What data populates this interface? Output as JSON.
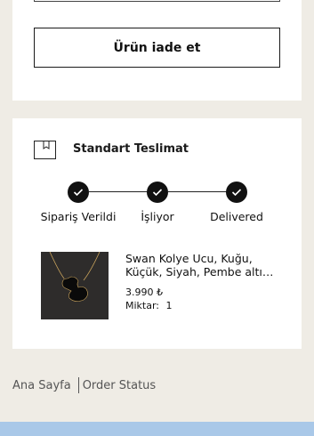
{
  "return_section": {
    "return_button_label": "Ürün iade et"
  },
  "delivery": {
    "icon": "box-icon",
    "title": "Standart Teslimat",
    "steps": [
      {
        "label": "Sipariş Verildi",
        "status": "done",
        "icon": "check-icon"
      },
      {
        "label": "İşliyor",
        "status": "done",
        "icon": "check-icon"
      },
      {
        "label": "Delivered",
        "status": "done",
        "icon": "check-icon"
      }
    ]
  },
  "product": {
    "name": "Swan Kolye Ucu, Kuğu, Küçük, Siyah, Pembe altı…",
    "price": "3.990 ₺",
    "quantity_label": "Miktar:",
    "quantity": "1"
  },
  "breadcrumb": {
    "items": [
      "Ana Sayfa",
      "Order Status"
    ]
  },
  "colors": {
    "page_background": "#efece5",
    "card_background": "#ffffff",
    "step_dot": "#111111",
    "bottom_bar": "#a9c8e8"
  }
}
